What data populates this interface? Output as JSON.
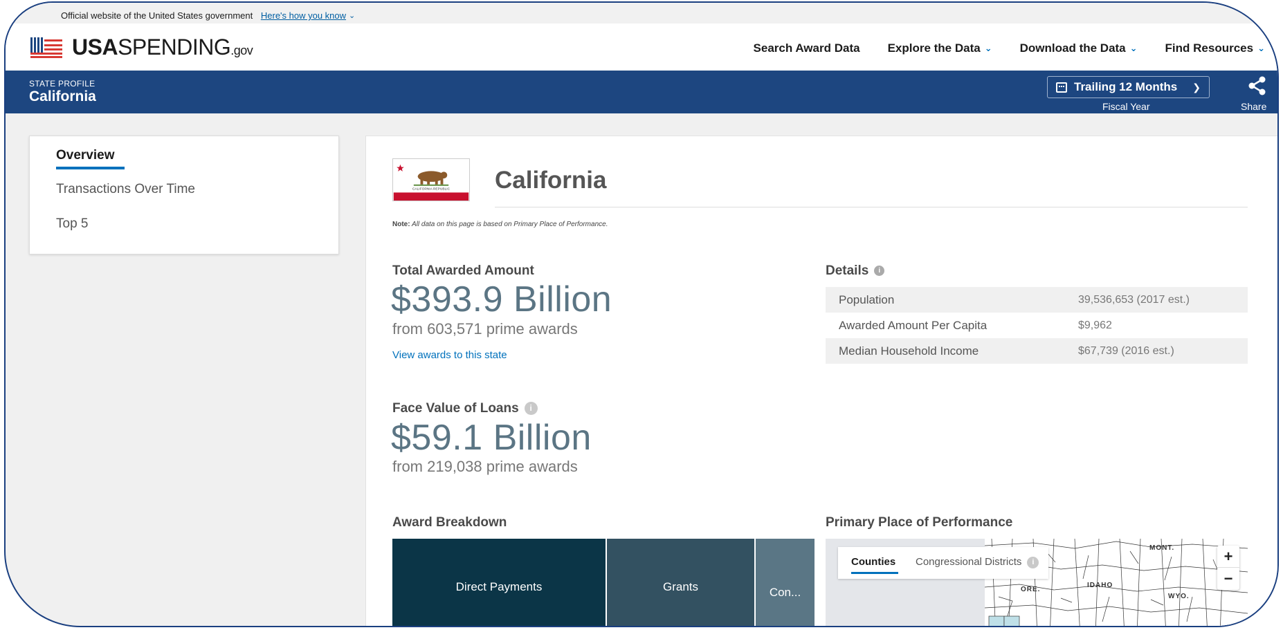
{
  "gov_banner": {
    "text": "Official website of the United States government",
    "link": "Here's how you know"
  },
  "header": {
    "logo_bold": "USA",
    "logo_rest": "SPENDING",
    "logo_suffix": ".gov",
    "nav": [
      {
        "label": "Search Award Data",
        "dropdown": false
      },
      {
        "label": "Explore the Data",
        "dropdown": true
      },
      {
        "label": "Download the Data",
        "dropdown": true
      },
      {
        "label": "Find Resources",
        "dropdown": true
      }
    ]
  },
  "state_bar": {
    "eyebrow": "STATE PROFILE",
    "name": "California",
    "fiscal_select": "Trailing 12 Months",
    "fiscal_caption": "Fiscal Year",
    "share_label": "Share"
  },
  "sidebar": {
    "items": [
      {
        "label": "Overview",
        "active": true
      },
      {
        "label": "Transactions Over Time",
        "active": false
      },
      {
        "label": "Top 5",
        "active": false
      }
    ]
  },
  "main": {
    "title": "California",
    "flag_text": "CALIFORNIA REPUBLIC",
    "note_label": "Note:",
    "note_text": "All data on this page is based on Primary Place of Performance.",
    "total": {
      "label": "Total Awarded Amount",
      "value": "$393.9 Billion",
      "sub": "from 603,571 prime awards",
      "link": "View awards to this state"
    },
    "loans": {
      "label": "Face Value of Loans",
      "value": "$59.1 Billion",
      "sub": "from 219,038 prime awards"
    },
    "details": {
      "label": "Details",
      "rows": [
        {
          "label": "Population",
          "value": "39,536,653 (2017 est.)"
        },
        {
          "label": "Awarded Amount Per Capita",
          "value": "$9,962"
        },
        {
          "label": "Median Household Income",
          "value": "$67,739 (2016 est.)"
        }
      ]
    },
    "breakdown": {
      "label": "Award Breakdown",
      "cells": [
        {
          "label": "Direct Payments",
          "color": "#0b3547"
        },
        {
          "label": "Grants",
          "color": "#335161"
        },
        {
          "label": "Con...",
          "color": "#5a7685"
        }
      ]
    },
    "map": {
      "label": "Primary Place of Performance",
      "tabs": [
        "Counties",
        "Congressional Districts"
      ],
      "active_tab": "Counties",
      "zoom_in": "+",
      "zoom_out": "−",
      "state_labels": [
        "MONT.",
        "ORE.",
        "IDAHO",
        "WYO."
      ]
    }
  }
}
